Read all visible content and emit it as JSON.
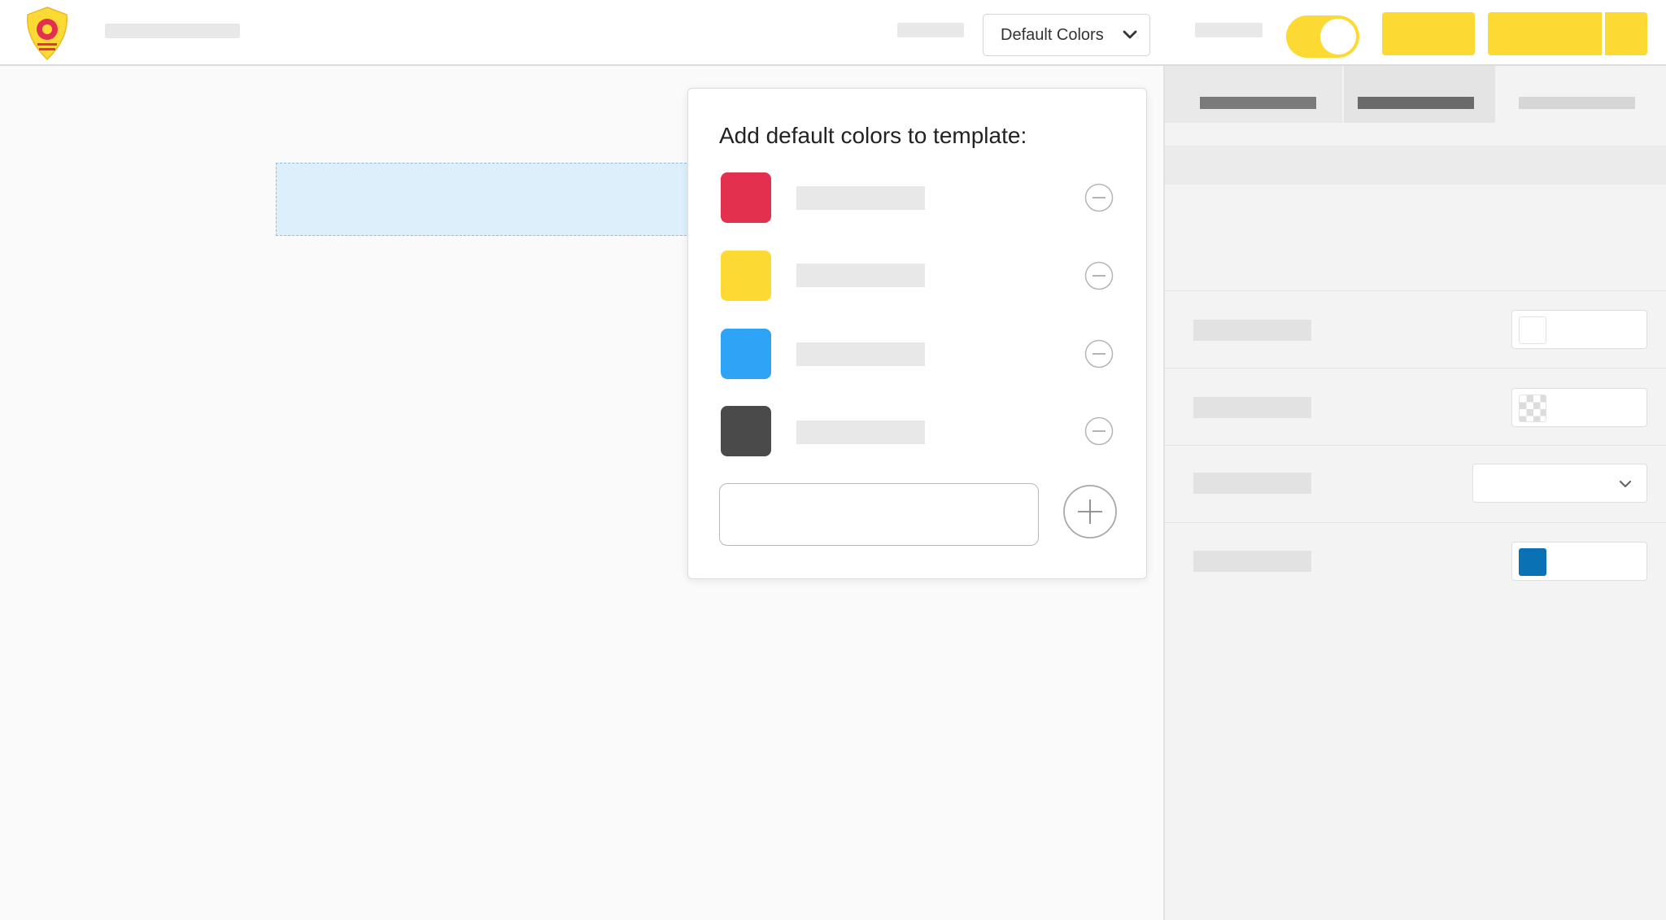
{
  "header": {
    "color_dropdown_label": "Default Colors",
    "toggle_on": true
  },
  "popup": {
    "title": "Add default colors to template:",
    "swatches": [
      {
        "color": "#e4304f"
      },
      {
        "color": "#fdd933"
      },
      {
        "color": "#2fa3f5"
      },
      {
        "color": "#4a4a4a"
      }
    ],
    "new_color_input": {
      "value": "",
      "placeholder": ""
    }
  },
  "properties_panel": {
    "active_tab_index": 2,
    "rows": [
      {
        "control": "color-field",
        "swatch": "#ffffff"
      },
      {
        "control": "color-field",
        "swatch": "transparent"
      },
      {
        "control": "select",
        "value": ""
      },
      {
        "control": "color-field",
        "swatch": "#0a71b4"
      }
    ]
  },
  "colors": {
    "accent": "#fdd933",
    "topbar_bg": "#ffffff",
    "canvas_bg": "#fafafa",
    "dropzone_bg": "#ddeffa"
  }
}
